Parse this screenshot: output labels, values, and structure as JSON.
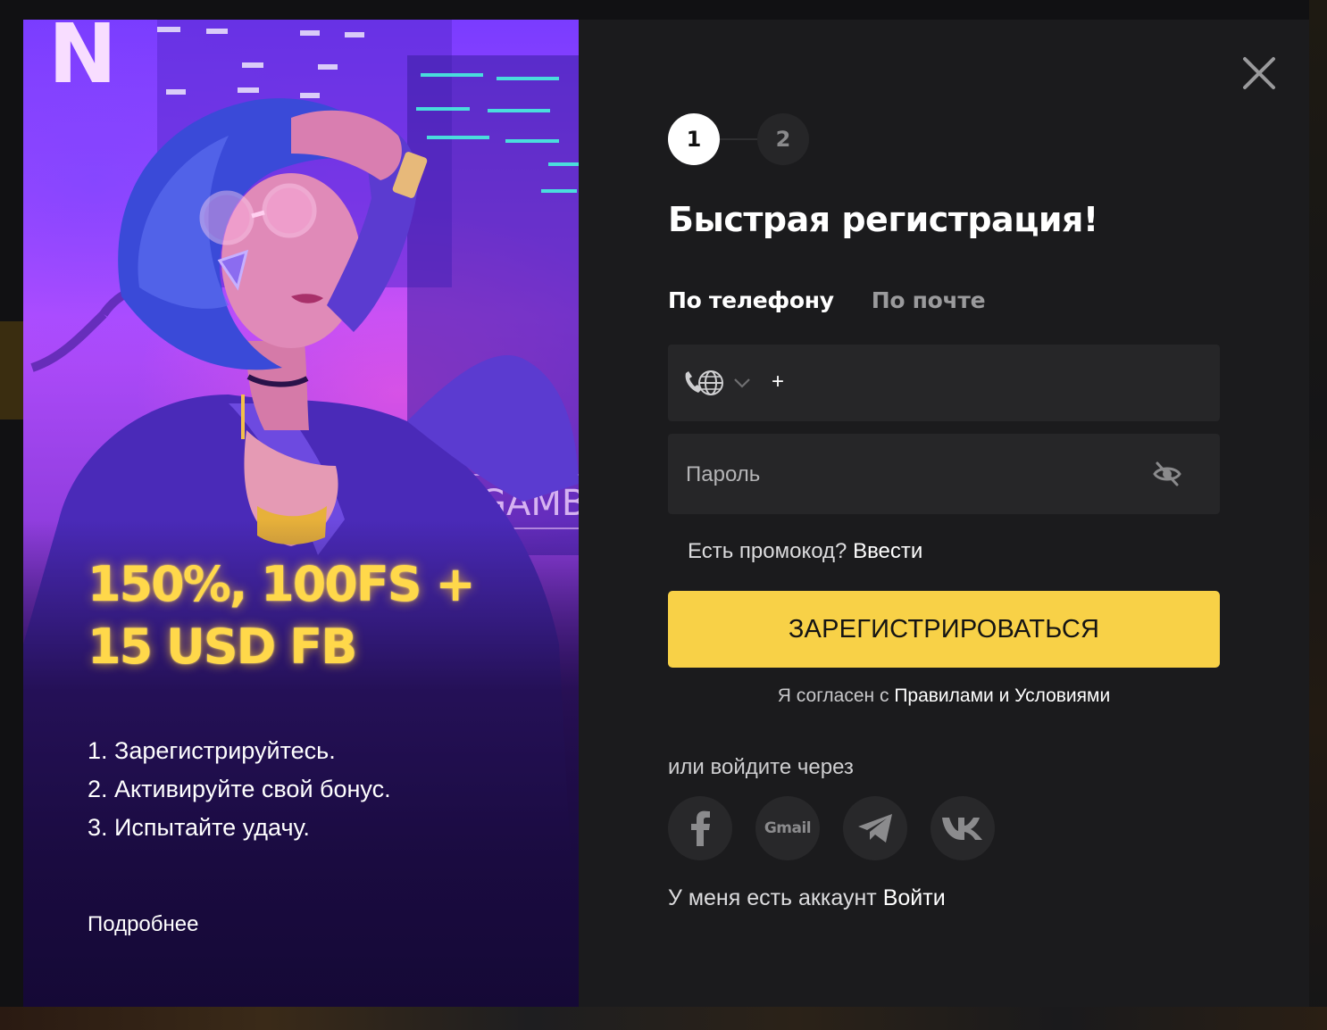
{
  "promo": {
    "headline": "150%, 100FS + 15 USD FB",
    "steps": [
      "1. Зарегистрируйтесь.",
      "2. Активируйте свой бонус.",
      "3. Испытайте удачу."
    ],
    "more_link": "Подробнее",
    "sign_text": "GAMB",
    "neon_letter": "N"
  },
  "stepper": {
    "step1": "1",
    "step2": "2"
  },
  "form": {
    "title": "Быстрая регистрация!",
    "tabs": [
      "По телефону",
      "По почте"
    ],
    "phone_prefix": "+",
    "phone_value": "",
    "password_placeholder": "Пароль",
    "promo_question": "Есть промокод?",
    "promo_link": "Ввести",
    "register_button": "ЗАРЕГИСТРИРОВАТЬСЯ",
    "agree_text": "Я согласен с",
    "agree_link": "Правилами и Условиями",
    "or_login_via": "или войдите через",
    "socials": [
      {
        "name": "facebook",
        "icon": "facebook-icon"
      },
      {
        "name": "gmail",
        "label": "Gmail",
        "icon": "gmail-icon"
      },
      {
        "name": "telegram",
        "icon": "telegram-icon"
      },
      {
        "name": "vk",
        "icon": "vk-icon"
      }
    ],
    "have_account": "У меня есть аккаунт",
    "login_link": "Войти"
  },
  "colors": {
    "accent_yellow": "#f8d147",
    "panel_bg": "#1b1b1d",
    "field_bg": "#262628",
    "headline_gold": "#ffd84a"
  }
}
